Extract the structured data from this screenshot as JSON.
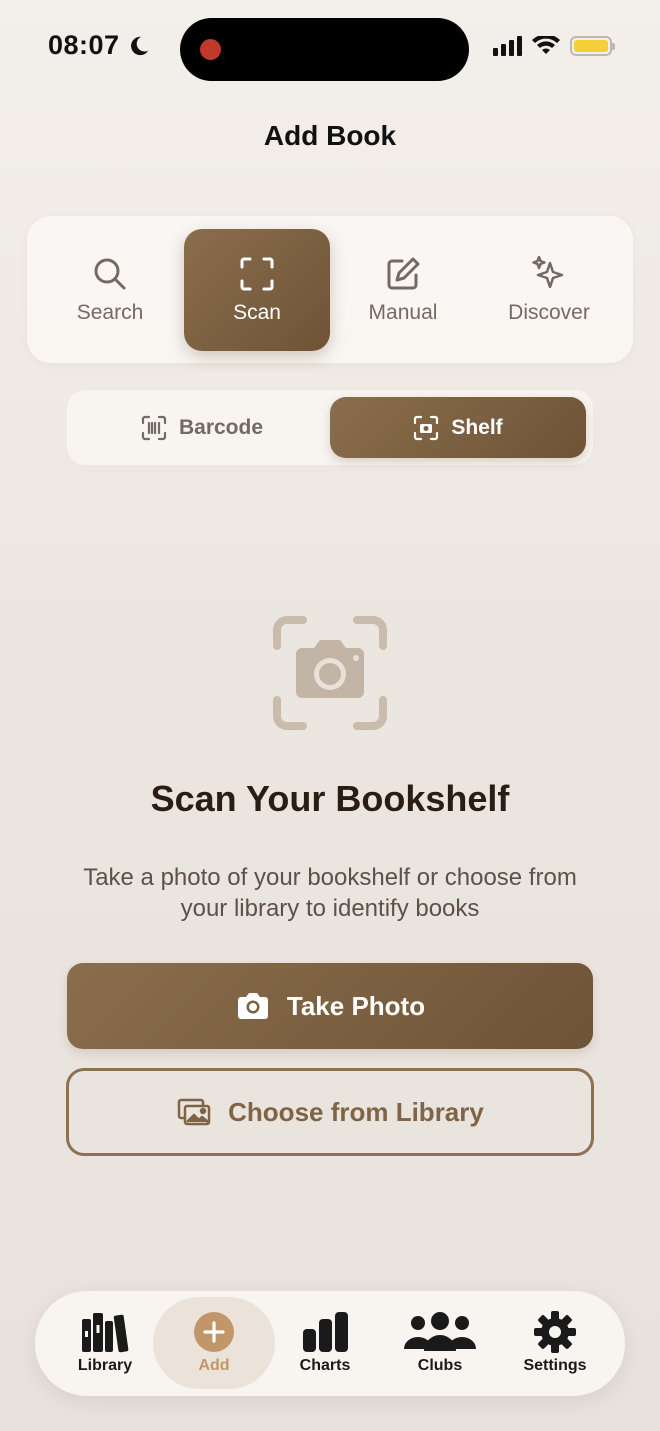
{
  "status": {
    "time": "08:07"
  },
  "header": {
    "title": "Add Book"
  },
  "modes": [
    {
      "label": "Search",
      "icon": "search-icon",
      "active": false
    },
    {
      "label": "Scan",
      "icon": "scan-frame-icon",
      "active": true
    },
    {
      "label": "Manual",
      "icon": "edit-icon",
      "active": false
    },
    {
      "label": "Discover",
      "icon": "sparkles-icon",
      "active": false
    }
  ],
  "scan_type": [
    {
      "label": "Barcode",
      "icon": "barcode-icon",
      "active": false
    },
    {
      "label": "Shelf",
      "icon": "camera-viewfinder-icon",
      "active": true
    }
  ],
  "hero": {
    "title": "Scan Your Bookshelf",
    "subtitle": "Take a photo of your bookshelf or choose from your library to identify books"
  },
  "actions": {
    "take_photo": "Take Photo",
    "choose_library": "Choose from Library"
  },
  "tabbar": [
    {
      "label": "Library",
      "icon": "books-icon",
      "active": false
    },
    {
      "label": "Add",
      "icon": "plus-circle-icon",
      "active": true
    },
    {
      "label": "Charts",
      "icon": "bar-chart-icon",
      "active": false
    },
    {
      "label": "Clubs",
      "icon": "people-icon",
      "active": false
    },
    {
      "label": "Settings",
      "icon": "gear-icon",
      "active": false
    }
  ],
  "colors": {
    "accent": "#7d6242",
    "accent_light": "#c19668",
    "background": "#efe9e3",
    "recording": "#c0392b",
    "battery": "#f5cf38"
  }
}
